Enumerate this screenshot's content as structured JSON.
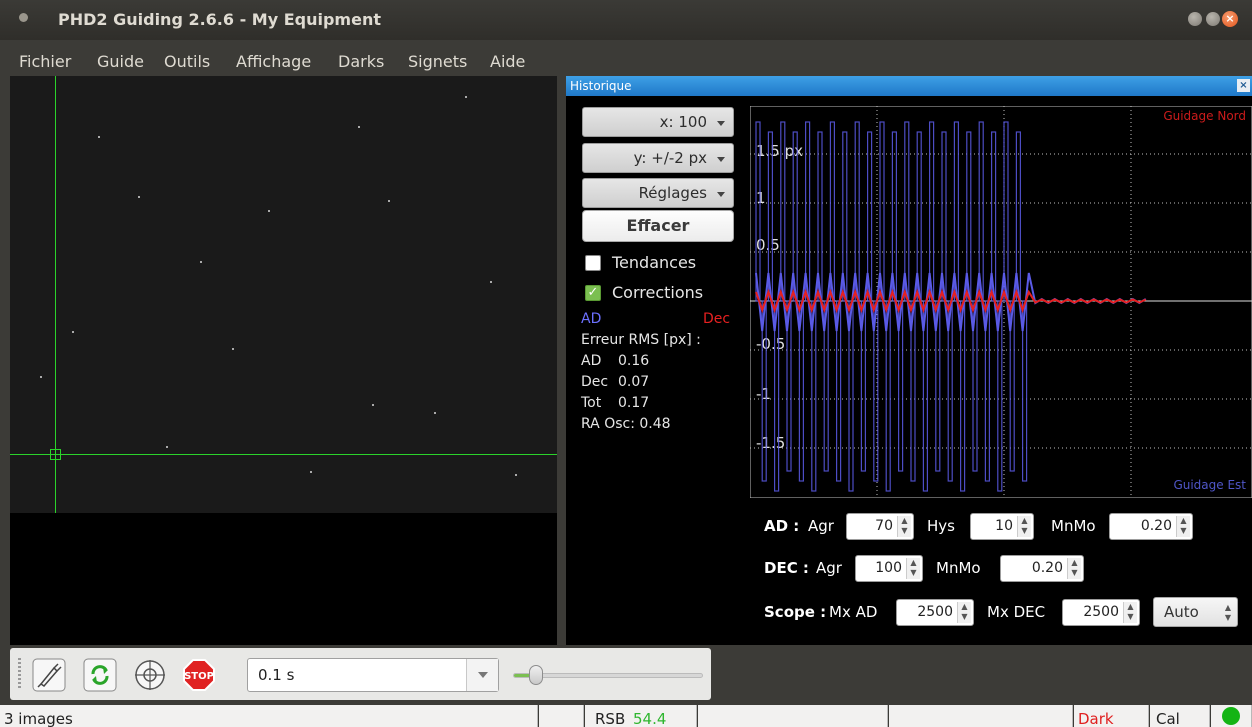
{
  "window": {
    "title": "PHD2 Guiding 2.6.6 - My Equipment",
    "close_glyph": "×"
  },
  "menu": [
    "Fichier",
    "Guide",
    "Outils",
    "Affichage",
    "Darks",
    "Signets",
    "Aide"
  ],
  "graph": {
    "title": "Historique",
    "close_glyph": "×",
    "x_scale": "x: 100",
    "y_scale": "y: +/-2 px",
    "settings": "Réglages",
    "clear": "Effacer",
    "trends_label": "Tendances",
    "trends_checked": false,
    "corrections_label": "Corrections",
    "corrections_checked": true,
    "legend_ra": "AD",
    "legend_dec": "Dec",
    "rms_title": "Erreur RMS [px] :",
    "stats": [
      {
        "label": "AD",
        "value": "0.16"
      },
      {
        "label": "Dec",
        "value": "0.07"
      },
      {
        "label": "Tot",
        "value": "0.17"
      }
    ],
    "ra_osc": "RA Osc: 0.48",
    "label_north": "Guidage Nord",
    "label_east": "Guidage Est",
    "y_ticks": [
      "1.5 px",
      "1",
      "0.5",
      "-0.5",
      "-1",
      "-1.5"
    ],
    "colors": {
      "ra": "#5a5ae6",
      "dec": "#e62020",
      "grid": "#bfbfbf",
      "north": "#cc1b1b",
      "east": "#4f56c7"
    },
    "ra_params": {
      "section": "AD :",
      "agr_label": "Agr",
      "agr": "70",
      "hys_label": "Hys",
      "hys": "10",
      "mnmo_label": "MnMo",
      "mnmo": "0.20"
    },
    "dec_params": {
      "section": "DEC :",
      "agr_label": "Agr",
      "agr": "100",
      "mnmo_label": "MnMo",
      "mnmo": "0.20"
    },
    "scope_params": {
      "section": "Scope :",
      "mxad_label": "Mx AD",
      "mxad": "2500",
      "mxdec_label": "Mx DEC",
      "mxdec": "2500",
      "mode": "Auto"
    }
  },
  "toolbar": {
    "stop_label": "STOP",
    "exposure": "0.1 s",
    "gain_level": 0.12
  },
  "status": {
    "frames": "3 images",
    "snr_label": "RSB",
    "snr_value": "54.4",
    "dark": "Dark",
    "cal": "Cal",
    "colors": {
      "snr": "#2fb62f",
      "dark": "#e02020",
      "ok": "#14b414"
    }
  }
}
